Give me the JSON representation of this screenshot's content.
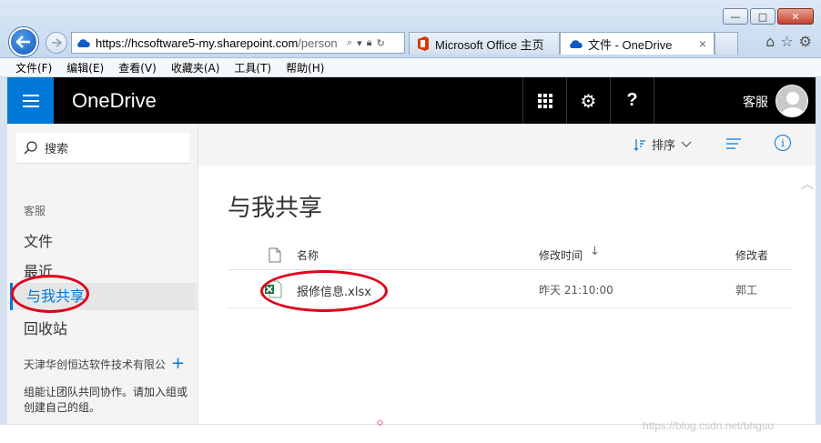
{
  "browser": {
    "url_domain": "https://hcsoftware5-my.sharepoint.com",
    "url_rest": "/person",
    "tabs": [
      {
        "label": "Microsoft Office 主页"
      },
      {
        "label": "文件 - OneDrive",
        "close": "×"
      }
    ],
    "window_buttons": {
      "minimize": "—",
      "maximize": "□",
      "close": "✕"
    }
  },
  "menu": [
    "文件(F)",
    "编辑(E)",
    "查看(V)",
    "收藏夹(A)",
    "工具(T)",
    "帮助(H)"
  ],
  "header": {
    "brand": "OneDrive",
    "user": "客服",
    "settings_glyph": "⚙",
    "help_glyph": "?"
  },
  "sidebar": {
    "search_label": "搜索",
    "section": "客服",
    "items": [
      {
        "label": "文件"
      },
      {
        "label": "最近"
      },
      {
        "label": "与我共享"
      },
      {
        "label": "回收站"
      }
    ],
    "team_label": "天津华创恒达软件技术有限公",
    "team_desc": "组能让团队共同协作。请加入组或创建自己的组。"
  },
  "commandbar": {
    "sort_label": "排序",
    "info_glyph": "i"
  },
  "main": {
    "title": "与我共享",
    "columns": {
      "name": "名称",
      "modified": "修改时间",
      "sort_arrow": "↓",
      "modified_by": "修改者"
    },
    "files": [
      {
        "name": "报修信息.xlsx",
        "modified": "昨天 21:10:00",
        "modified_by": "郭工"
      }
    ]
  },
  "watermark": "https://blog.csdn.net/bhguo",
  "colors": {
    "accent": "#0078d7",
    "annotation": "#e0001a",
    "header_bg": "#000000"
  }
}
